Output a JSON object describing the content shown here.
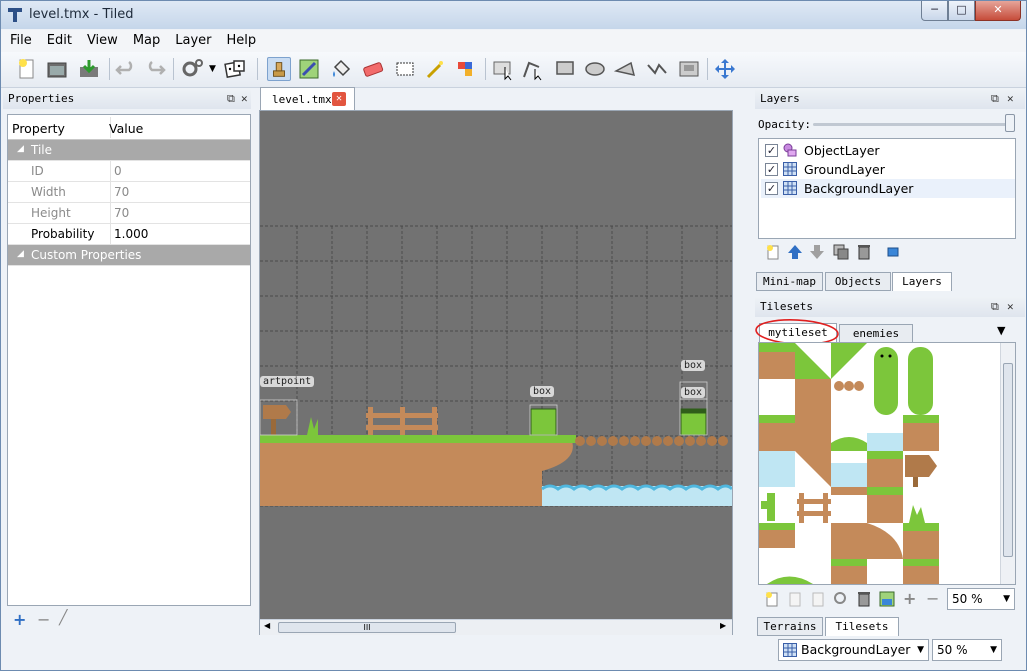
{
  "window": {
    "title": "level.tmx - Tiled",
    "minimize": "─",
    "maximize": "□",
    "close": "✕"
  },
  "menu": [
    "File",
    "Edit",
    "View",
    "Map",
    "Layer",
    "Help"
  ],
  "toolbar_icons": [
    "new-file-icon",
    "open-folder-icon",
    "save-icon",
    "undo-icon",
    "redo-icon",
    "commands-icon",
    "random-mode-icon",
    "stamp-brush-icon",
    "terrain-brush-icon",
    "bucket-fill-icon",
    "eraser-icon",
    "rectangle-select-icon",
    "magic-wand-icon",
    "select-same-tile-icon",
    "select-objects-icon",
    "edit-polygons-icon",
    "insert-rectangle-icon",
    "insert-ellipse-icon",
    "insert-polygon-icon",
    "insert-polyline-icon",
    "insert-tile-icon",
    "move-icon"
  ],
  "properties": {
    "title": "Properties",
    "col_property": "Property",
    "col_value": "Value",
    "group_tile": "Tile",
    "rows": [
      {
        "k": "ID",
        "v": "0"
      },
      {
        "k": "Width",
        "v": "70"
      },
      {
        "k": "Height",
        "v": "70"
      },
      {
        "k": "Probability",
        "v": "1.000"
      }
    ],
    "group_custom": "Custom Properties"
  },
  "document": {
    "tab": "level.tmx",
    "scroll_grip": "III"
  },
  "map_labels": {
    "startpoint": "artpoint",
    "box1": "box",
    "box2": "box",
    "box3": "box"
  },
  "layers": {
    "title": "Layers",
    "opacity_label": "Opacity:",
    "opacity": 1.0,
    "items": [
      {
        "name": "ObjectLayer",
        "icon": "object-layer-icon",
        "checked": "✓"
      },
      {
        "name": "GroundLayer",
        "icon": "tile-layer-icon",
        "checked": "✓"
      },
      {
        "name": "BackgroundLayer",
        "icon": "tile-layer-icon",
        "checked": "✓"
      }
    ],
    "tabs": [
      "Mini-map",
      "Objects",
      "Layers"
    ]
  },
  "tilesets": {
    "title": "Tilesets",
    "tabs": [
      "mytileset",
      "enemies"
    ],
    "zoom": "50 %",
    "bottom_tabs": [
      "Terrains",
      "Tilesets"
    ]
  },
  "statusbar": {
    "layer": "BackgroundLayer",
    "zoom": "50 %"
  },
  "colors": {
    "grass": "#7cc63b",
    "dirt": "#c48a5a",
    "water": "#bfe6f3",
    "annotation": "#e02020"
  }
}
